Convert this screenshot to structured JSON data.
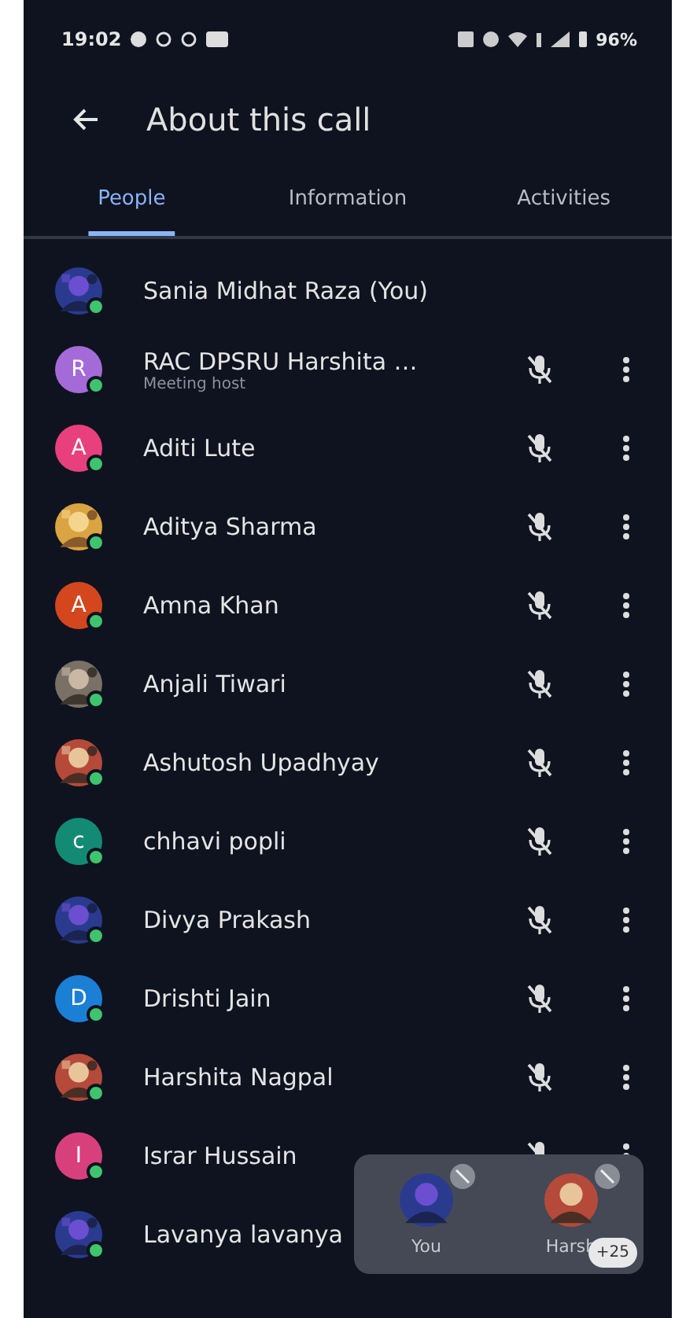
{
  "status_bar": {
    "time": "19:02",
    "battery": "96%"
  },
  "header": {
    "title": "About this call"
  },
  "tabs": [
    {
      "label": "People",
      "selected": true
    },
    {
      "label": "Information",
      "selected": false
    },
    {
      "label": "Activities",
      "selected": false
    }
  ],
  "participants": [
    {
      "name": "Sania Midhat Raza (You)",
      "actions": false
    },
    {
      "name": "RAC DPSRU Harshita …",
      "subtitle": "Meeting host",
      "avatar": {
        "kind": "initial",
        "letter": "R",
        "color": "#a46bd8"
      },
      "actions": true
    },
    {
      "name": "Aditi Lute",
      "avatar": {
        "kind": "initial",
        "letter": "A",
        "color": "#e8407c"
      },
      "actions": true
    },
    {
      "name": "Aditya Sharma",
      "actions": true
    },
    {
      "name": "Amna Khan",
      "avatar": {
        "kind": "initial",
        "letter": "A",
        "color": "#d4461e"
      },
      "actions": true
    },
    {
      "name": "Anjali Tiwari",
      "actions": true
    },
    {
      "name": "Ashutosh Upadhyay",
      "actions": true
    },
    {
      "name": "chhavi popli",
      "avatar": {
        "kind": "initial",
        "letter": "c",
        "color": "#138a74"
      },
      "actions": true
    },
    {
      "name": "Divya Prakash",
      "actions": true
    },
    {
      "name": "Drishti Jain",
      "avatar": {
        "kind": "initial",
        "letter": "D",
        "color": "#1c7fd6"
      },
      "actions": true
    },
    {
      "name": "Harshita Nagpal",
      "actions": true
    },
    {
      "name": "Israr Hussain",
      "avatar": {
        "kind": "initial",
        "letter": "I",
        "color": "#d8407c"
      },
      "actions": true
    },
    {
      "name": "Lavanya lavanya",
      "actions": false
    }
  ],
  "pip": {
    "tiles": [
      {
        "label": "You"
      },
      {
        "label": "Harsh"
      }
    ],
    "badge": "+25"
  }
}
